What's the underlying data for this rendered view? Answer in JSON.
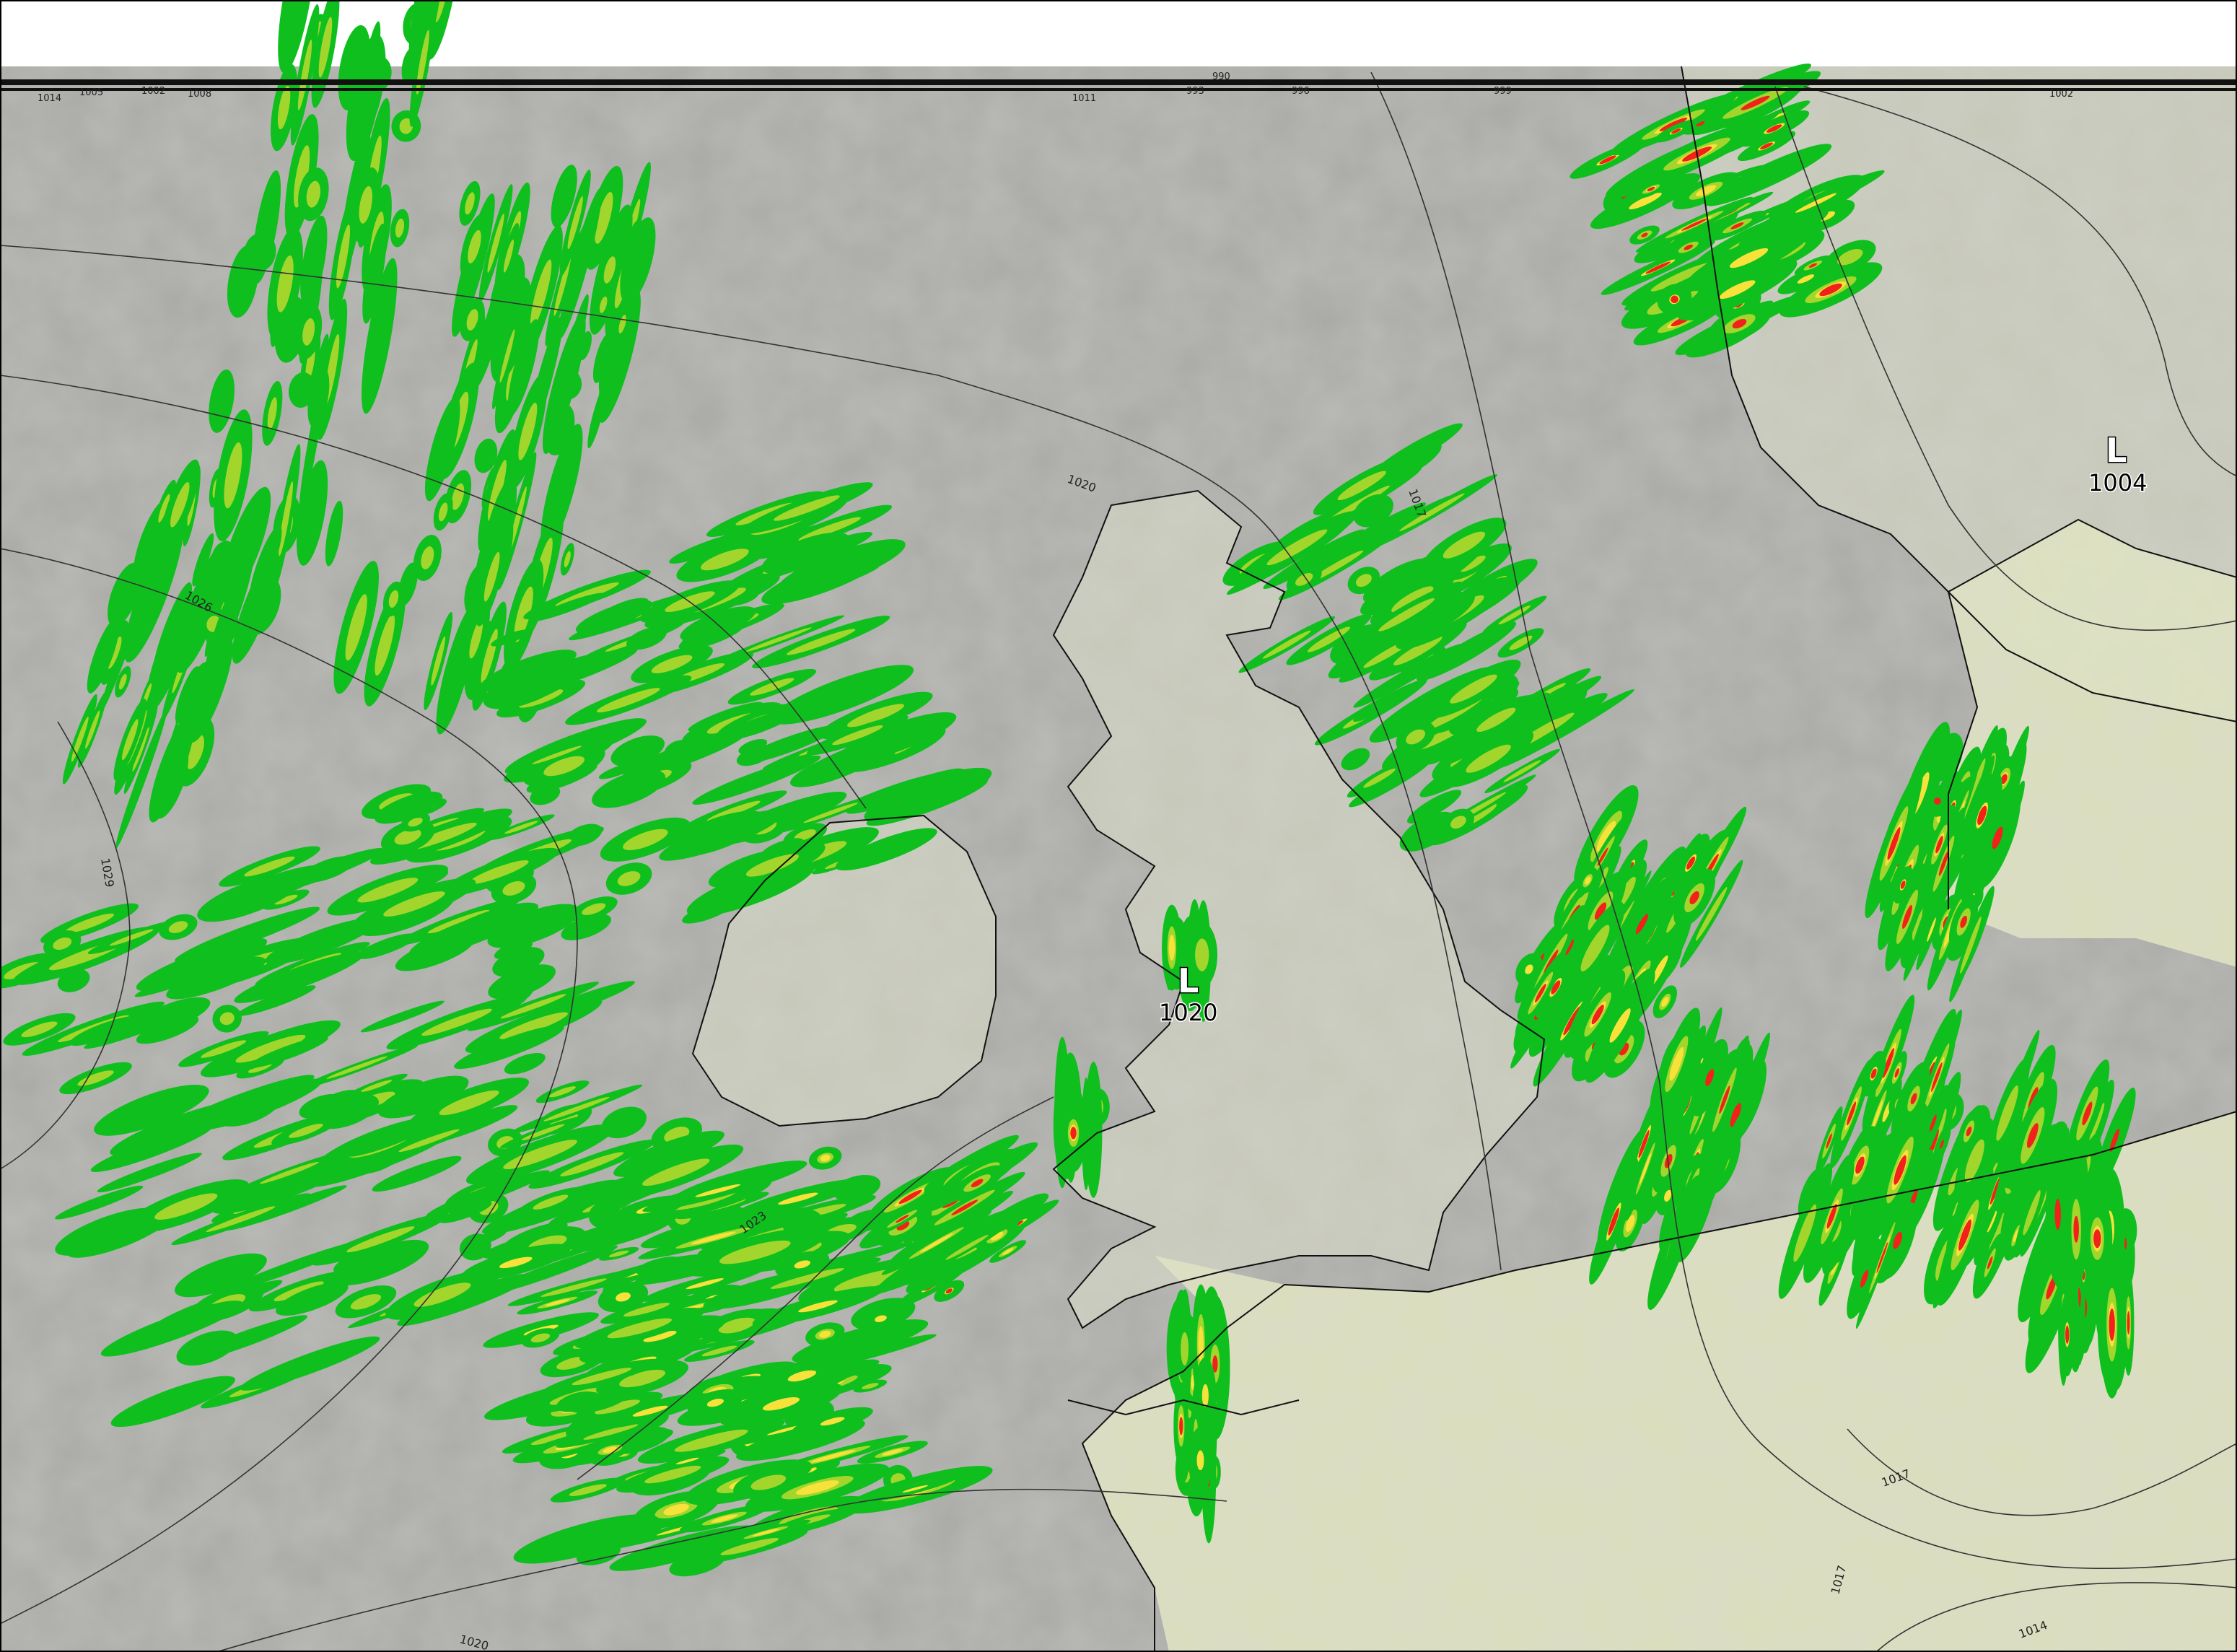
{
  "map": {
    "type": "weather-forecast-map",
    "region": "British Isles and North-West Europe",
    "colors": {
      "sea_cloud": "#a9aaa6",
      "land_cloud": "#c9cbbb",
      "land_clear": "#dfe3bf",
      "precip_light": "#0fbf1e",
      "precip_moderate": "#a3d62d",
      "precip_heavy": "#f6e23b",
      "precip_intense": "#f1221a",
      "coastline": "#111111",
      "isobar": "#333333"
    },
    "pressure_systems": [
      {
        "type": "low",
        "letter": "L",
        "value": "1020"
      },
      {
        "type": "low",
        "letter": "L",
        "value": "1004"
      }
    ],
    "isobar_labels": [
      "1026",
      "1029",
      "1023",
      "1020",
      "1020",
      "1017",
      "1017",
      "1017",
      "1014"
    ],
    "top_strip_labels": [
      "1014",
      "1005",
      "1002",
      "1008",
      "1011",
      "990",
      "993",
      "996",
      "999",
      "1002"
    ]
  }
}
